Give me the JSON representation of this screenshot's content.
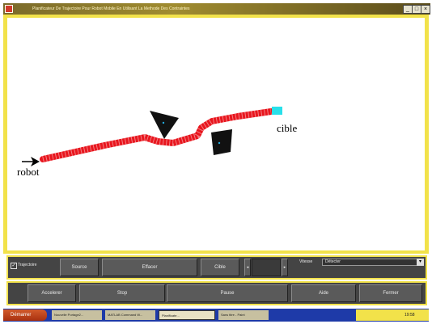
{
  "window": {
    "title": "Planificateur De Trajectoire Pour Robot Mobile En Utilisant La Methode Des Contraintes",
    "min_icon": "minimize-icon",
    "max_icon": "maximize-icon",
    "close_icon": "close-icon",
    "min_glyph": "_",
    "max_glyph": "□",
    "close_glyph": "×"
  },
  "scene": {
    "robot_label": "robot",
    "target_label": "cible",
    "path_color": "#e8161e",
    "target_color": "#28e0ea",
    "obstacle_color": "#111111"
  },
  "controls": {
    "trajectory_check": "✓",
    "trajectory_label": "Trajectoire",
    "source_button": "Source",
    "erase_button": "Effacer",
    "target_button": "Cible",
    "stepper_left": "◂",
    "stepper_right": "▸",
    "speed_label": "Vitesse",
    "speed_value": "Détecter",
    "speed_arrow": "▾"
  },
  "actions": {
    "accelerate": "Accelerer",
    "stop": "Stop",
    "pause": "Pause",
    "help": "Aide",
    "close": "Fermer"
  },
  "taskbar": {
    "start": "Démarrer",
    "tasks": [
      "Nouvelle Portage2...",
      "MATLAB Command W...",
      "Planificate...",
      "Sans titre - Paint"
    ],
    "clock": "19:58"
  }
}
